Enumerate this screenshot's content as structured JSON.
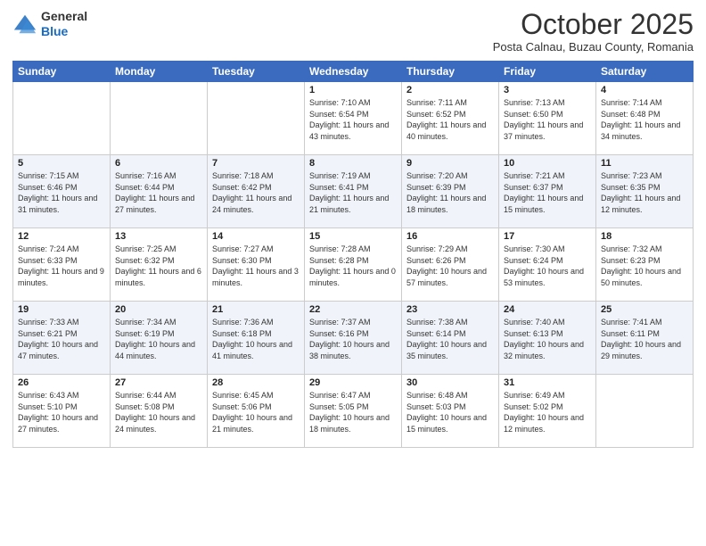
{
  "header": {
    "logo_line1": "General",
    "logo_line2": "Blue",
    "month": "October 2025",
    "location": "Posta Calnau, Buzau County, Romania"
  },
  "days_of_week": [
    "Sunday",
    "Monday",
    "Tuesday",
    "Wednesday",
    "Thursday",
    "Friday",
    "Saturday"
  ],
  "weeks": [
    [
      {
        "day": "",
        "sunrise": "",
        "sunset": "",
        "daylight": ""
      },
      {
        "day": "",
        "sunrise": "",
        "sunset": "",
        "daylight": ""
      },
      {
        "day": "",
        "sunrise": "",
        "sunset": "",
        "daylight": ""
      },
      {
        "day": "1",
        "sunrise": "Sunrise: 7:10 AM",
        "sunset": "Sunset: 6:54 PM",
        "daylight": "Daylight: 11 hours and 43 minutes."
      },
      {
        "day": "2",
        "sunrise": "Sunrise: 7:11 AM",
        "sunset": "Sunset: 6:52 PM",
        "daylight": "Daylight: 11 hours and 40 minutes."
      },
      {
        "day": "3",
        "sunrise": "Sunrise: 7:13 AM",
        "sunset": "Sunset: 6:50 PM",
        "daylight": "Daylight: 11 hours and 37 minutes."
      },
      {
        "day": "4",
        "sunrise": "Sunrise: 7:14 AM",
        "sunset": "Sunset: 6:48 PM",
        "daylight": "Daylight: 11 hours and 34 minutes."
      }
    ],
    [
      {
        "day": "5",
        "sunrise": "Sunrise: 7:15 AM",
        "sunset": "Sunset: 6:46 PM",
        "daylight": "Daylight: 11 hours and 31 minutes."
      },
      {
        "day": "6",
        "sunrise": "Sunrise: 7:16 AM",
        "sunset": "Sunset: 6:44 PM",
        "daylight": "Daylight: 11 hours and 27 minutes."
      },
      {
        "day": "7",
        "sunrise": "Sunrise: 7:18 AM",
        "sunset": "Sunset: 6:42 PM",
        "daylight": "Daylight: 11 hours and 24 minutes."
      },
      {
        "day": "8",
        "sunrise": "Sunrise: 7:19 AM",
        "sunset": "Sunset: 6:41 PM",
        "daylight": "Daylight: 11 hours and 21 minutes."
      },
      {
        "day": "9",
        "sunrise": "Sunrise: 7:20 AM",
        "sunset": "Sunset: 6:39 PM",
        "daylight": "Daylight: 11 hours and 18 minutes."
      },
      {
        "day": "10",
        "sunrise": "Sunrise: 7:21 AM",
        "sunset": "Sunset: 6:37 PM",
        "daylight": "Daylight: 11 hours and 15 minutes."
      },
      {
        "day": "11",
        "sunrise": "Sunrise: 7:23 AM",
        "sunset": "Sunset: 6:35 PM",
        "daylight": "Daylight: 11 hours and 12 minutes."
      }
    ],
    [
      {
        "day": "12",
        "sunrise": "Sunrise: 7:24 AM",
        "sunset": "Sunset: 6:33 PM",
        "daylight": "Daylight: 11 hours and 9 minutes."
      },
      {
        "day": "13",
        "sunrise": "Sunrise: 7:25 AM",
        "sunset": "Sunset: 6:32 PM",
        "daylight": "Daylight: 11 hours and 6 minutes."
      },
      {
        "day": "14",
        "sunrise": "Sunrise: 7:27 AM",
        "sunset": "Sunset: 6:30 PM",
        "daylight": "Daylight: 11 hours and 3 minutes."
      },
      {
        "day": "15",
        "sunrise": "Sunrise: 7:28 AM",
        "sunset": "Sunset: 6:28 PM",
        "daylight": "Daylight: 11 hours and 0 minutes."
      },
      {
        "day": "16",
        "sunrise": "Sunrise: 7:29 AM",
        "sunset": "Sunset: 6:26 PM",
        "daylight": "Daylight: 10 hours and 57 minutes."
      },
      {
        "day": "17",
        "sunrise": "Sunrise: 7:30 AM",
        "sunset": "Sunset: 6:24 PM",
        "daylight": "Daylight: 10 hours and 53 minutes."
      },
      {
        "day": "18",
        "sunrise": "Sunrise: 7:32 AM",
        "sunset": "Sunset: 6:23 PM",
        "daylight": "Daylight: 10 hours and 50 minutes."
      }
    ],
    [
      {
        "day": "19",
        "sunrise": "Sunrise: 7:33 AM",
        "sunset": "Sunset: 6:21 PM",
        "daylight": "Daylight: 10 hours and 47 minutes."
      },
      {
        "day": "20",
        "sunrise": "Sunrise: 7:34 AM",
        "sunset": "Sunset: 6:19 PM",
        "daylight": "Daylight: 10 hours and 44 minutes."
      },
      {
        "day": "21",
        "sunrise": "Sunrise: 7:36 AM",
        "sunset": "Sunset: 6:18 PM",
        "daylight": "Daylight: 10 hours and 41 minutes."
      },
      {
        "day": "22",
        "sunrise": "Sunrise: 7:37 AM",
        "sunset": "Sunset: 6:16 PM",
        "daylight": "Daylight: 10 hours and 38 minutes."
      },
      {
        "day": "23",
        "sunrise": "Sunrise: 7:38 AM",
        "sunset": "Sunset: 6:14 PM",
        "daylight": "Daylight: 10 hours and 35 minutes."
      },
      {
        "day": "24",
        "sunrise": "Sunrise: 7:40 AM",
        "sunset": "Sunset: 6:13 PM",
        "daylight": "Daylight: 10 hours and 32 minutes."
      },
      {
        "day": "25",
        "sunrise": "Sunrise: 7:41 AM",
        "sunset": "Sunset: 6:11 PM",
        "daylight": "Daylight: 10 hours and 29 minutes."
      }
    ],
    [
      {
        "day": "26",
        "sunrise": "Sunrise: 6:43 AM",
        "sunset": "Sunset: 5:10 PM",
        "daylight": "Daylight: 10 hours and 27 minutes."
      },
      {
        "day": "27",
        "sunrise": "Sunrise: 6:44 AM",
        "sunset": "Sunset: 5:08 PM",
        "daylight": "Daylight: 10 hours and 24 minutes."
      },
      {
        "day": "28",
        "sunrise": "Sunrise: 6:45 AM",
        "sunset": "Sunset: 5:06 PM",
        "daylight": "Daylight: 10 hours and 21 minutes."
      },
      {
        "day": "29",
        "sunrise": "Sunrise: 6:47 AM",
        "sunset": "Sunset: 5:05 PM",
        "daylight": "Daylight: 10 hours and 18 minutes."
      },
      {
        "day": "30",
        "sunrise": "Sunrise: 6:48 AM",
        "sunset": "Sunset: 5:03 PM",
        "daylight": "Daylight: 10 hours and 15 minutes."
      },
      {
        "day": "31",
        "sunrise": "Sunrise: 6:49 AM",
        "sunset": "Sunset: 5:02 PM",
        "daylight": "Daylight: 10 hours and 12 minutes."
      },
      {
        "day": "",
        "sunrise": "",
        "sunset": "",
        "daylight": ""
      }
    ]
  ]
}
